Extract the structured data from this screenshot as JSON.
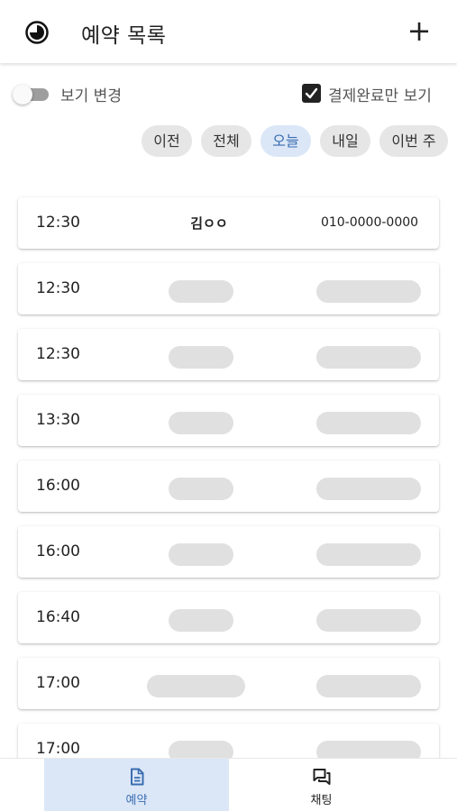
{
  "header": {
    "title": "예약 목록",
    "add_label": "+"
  },
  "controls": {
    "toggle_label": "보기 변경",
    "toggle_on": false,
    "paid_only_label": "결제완료만 보기",
    "paid_only_checked": true
  },
  "filters": [
    {
      "label": "이전",
      "active": false
    },
    {
      "label": "전체",
      "active": false
    },
    {
      "label": "오늘",
      "active": true
    },
    {
      "label": "내일",
      "active": false
    },
    {
      "label": "이번 주",
      "active": false
    }
  ],
  "reservations": [
    {
      "time": "12:30",
      "name": "김ㅇㅇ",
      "phone": "010-0000-0000"
    },
    {
      "time": "12:30",
      "name": null,
      "phone": null
    },
    {
      "time": "12:30",
      "name": null,
      "phone": null
    },
    {
      "time": "13:30",
      "name": null,
      "phone": null
    },
    {
      "time": "16:00",
      "name": null,
      "phone": null
    },
    {
      "time": "16:00",
      "name": null,
      "phone": null
    },
    {
      "time": "16:40",
      "name": null,
      "phone": null
    },
    {
      "time": "17:00",
      "name": null,
      "phone": null
    },
    {
      "time": "17:00",
      "name": null,
      "phone": null
    }
  ],
  "bottom_nav": [
    {
      "label": "예약",
      "icon": "document-icon",
      "active": true
    },
    {
      "label": "채팅",
      "icon": "chat-icon",
      "active": false
    }
  ],
  "colors": {
    "accent": "#3a6db0",
    "active_bg": "#dbe7f7",
    "chip_bg": "#e6e6e6",
    "blur": "#e0e0e0"
  }
}
